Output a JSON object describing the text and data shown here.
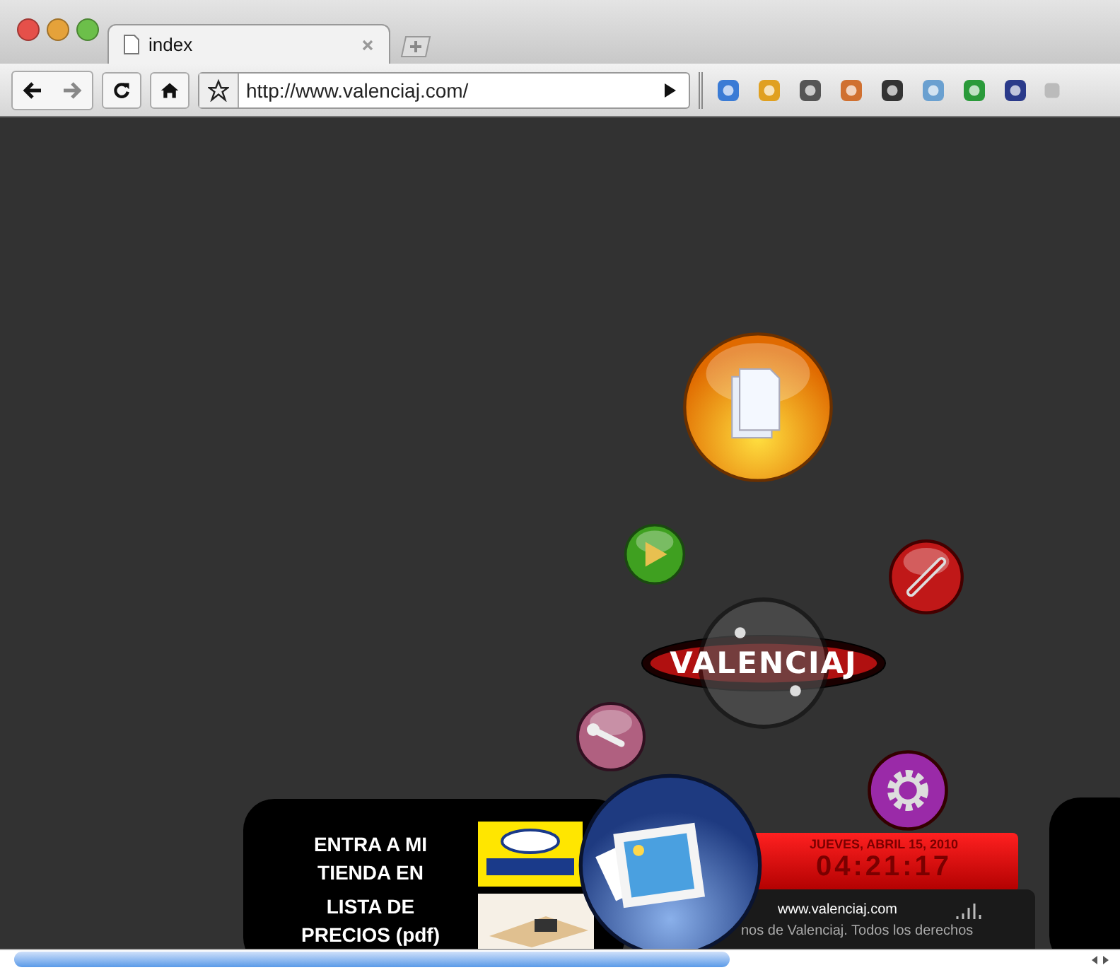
{
  "browser": {
    "tab": {
      "title": "index"
    },
    "address": {
      "value": "http://www.valenciaj.com/"
    }
  },
  "logo": {
    "text": "VALENCIAJ"
  },
  "footer": {
    "store_link": "ENTRA A MI TIENDA EN",
    "price_list_link": "LISTA DE PRECIOS (pdf)",
    "clock": {
      "date": "JUEVES, ABRIL 15, 2010",
      "time": "04:21:17"
    },
    "site": "www.valenciaj.com",
    "copyright": "nos de Valenciaj. Todos los derechos"
  }
}
